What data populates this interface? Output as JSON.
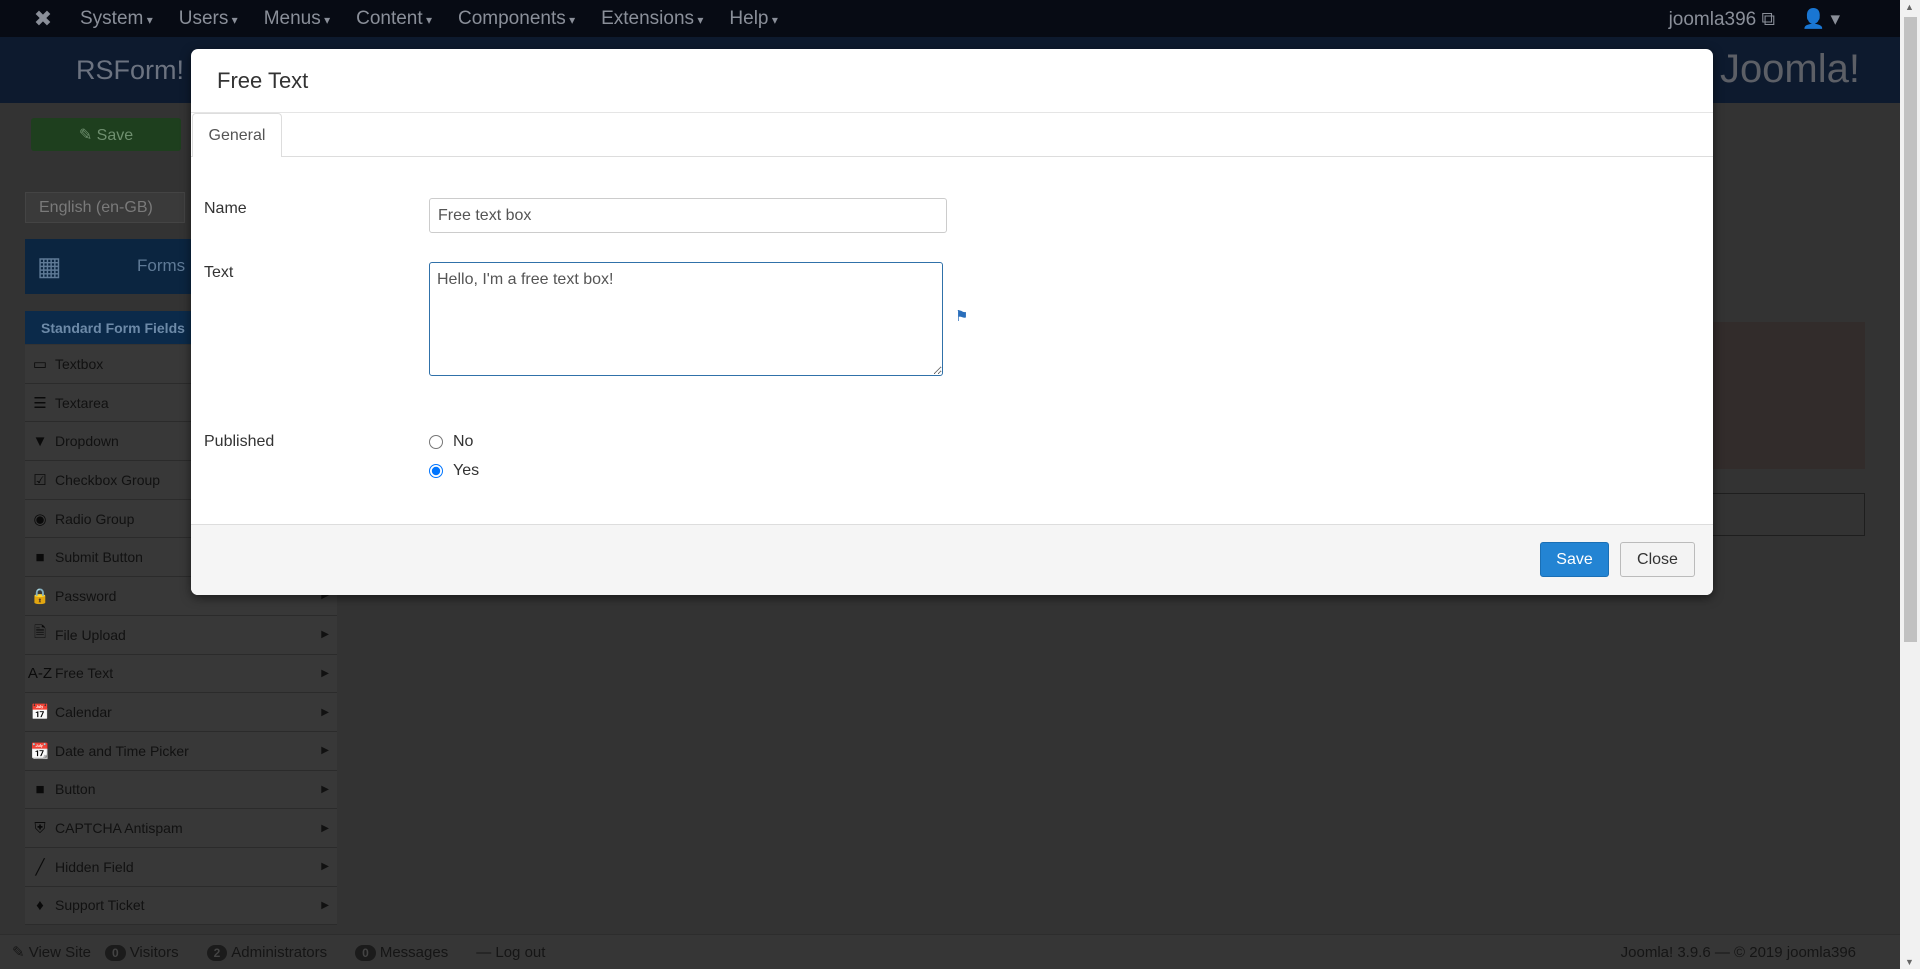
{
  "navbar": {
    "menus": [
      "System",
      "Users",
      "Menus",
      "Content",
      "Components",
      "Extensions",
      "Help"
    ],
    "user": "joomla396 ⧉",
    "user_menu": "👤 ▾"
  },
  "header": {
    "title": "RSForm! Pro - Manage Forms",
    "brand": "Joomla!"
  },
  "toolbar": {
    "save_label": "✎ Save"
  },
  "sidebar": {
    "language": "English (en-GB)",
    "forms_label": "Forms",
    "section": "Standard Form Fields",
    "items": [
      {
        "label": "Textbox",
        "icon": "▭"
      },
      {
        "label": "Textarea",
        "icon": "☰"
      },
      {
        "label": "Dropdown",
        "icon": "▼"
      },
      {
        "label": "Checkbox Group",
        "icon": "☑"
      },
      {
        "label": "Radio Group",
        "icon": "◉"
      },
      {
        "label": "Submit Button",
        "icon": "■"
      },
      {
        "label": "Password",
        "icon": "🔒"
      },
      {
        "label": "File Upload",
        "icon": "🗎"
      },
      {
        "label": "Free Text",
        "icon": "A-Z"
      },
      {
        "label": "Calendar",
        "icon": "📅"
      },
      {
        "label": "Date and Time Picker",
        "icon": "📆"
      },
      {
        "label": "Button",
        "icon": "■"
      },
      {
        "label": "CAPTCHA Antispam",
        "icon": "⛨"
      },
      {
        "label": "Hidden Field",
        "icon": "╱"
      },
      {
        "label": "Support Ticket",
        "icon": "♦"
      }
    ]
  },
  "status": {
    "view_site": "✎ View Site",
    "visitors_count": "0",
    "visitors": "Visitors",
    "admins_count": "2",
    "admins": "Administrators",
    "messages_count": "0",
    "messages": "Messages",
    "logout": "— Log out",
    "copyright": "Joomla! 3.9.6 — © 2019 joomla396"
  },
  "modal": {
    "title": "Free Text",
    "tab": "General",
    "name_label": "Name",
    "name_value": "Free text box",
    "text_label": "Text",
    "text_value": "Hello, I'm a free text box!",
    "published_label": "Published",
    "options": [
      "No",
      "Yes"
    ],
    "selected": "Yes",
    "save": "Save",
    "close": "Close"
  },
  "colors": {
    "accent": "#2384d3",
    "overlay": "rgba(0,0,0,0.8)"
  }
}
